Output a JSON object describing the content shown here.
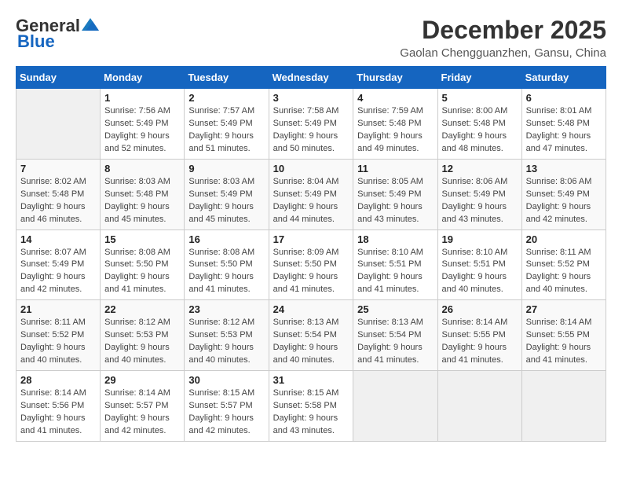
{
  "header": {
    "logo_general": "General",
    "logo_blue": "Blue",
    "month_year": "December 2025",
    "location": "Gaolan Chengguanzhen, Gansu, China"
  },
  "weekdays": [
    "Sunday",
    "Monday",
    "Tuesday",
    "Wednesday",
    "Thursday",
    "Friday",
    "Saturday"
  ],
  "weeks": [
    [
      {
        "day": "",
        "info": ""
      },
      {
        "day": "1",
        "info": "Sunrise: 7:56 AM\nSunset: 5:49 PM\nDaylight: 9 hours\nand 52 minutes."
      },
      {
        "day": "2",
        "info": "Sunrise: 7:57 AM\nSunset: 5:49 PM\nDaylight: 9 hours\nand 51 minutes."
      },
      {
        "day": "3",
        "info": "Sunrise: 7:58 AM\nSunset: 5:49 PM\nDaylight: 9 hours\nand 50 minutes."
      },
      {
        "day": "4",
        "info": "Sunrise: 7:59 AM\nSunset: 5:48 PM\nDaylight: 9 hours\nand 49 minutes."
      },
      {
        "day": "5",
        "info": "Sunrise: 8:00 AM\nSunset: 5:48 PM\nDaylight: 9 hours\nand 48 minutes."
      },
      {
        "day": "6",
        "info": "Sunrise: 8:01 AM\nSunset: 5:48 PM\nDaylight: 9 hours\nand 47 minutes."
      }
    ],
    [
      {
        "day": "7",
        "info": "Sunrise: 8:02 AM\nSunset: 5:48 PM\nDaylight: 9 hours\nand 46 minutes."
      },
      {
        "day": "8",
        "info": "Sunrise: 8:03 AM\nSunset: 5:48 PM\nDaylight: 9 hours\nand 45 minutes."
      },
      {
        "day": "9",
        "info": "Sunrise: 8:03 AM\nSunset: 5:49 PM\nDaylight: 9 hours\nand 45 minutes."
      },
      {
        "day": "10",
        "info": "Sunrise: 8:04 AM\nSunset: 5:49 PM\nDaylight: 9 hours\nand 44 minutes."
      },
      {
        "day": "11",
        "info": "Sunrise: 8:05 AM\nSunset: 5:49 PM\nDaylight: 9 hours\nand 43 minutes."
      },
      {
        "day": "12",
        "info": "Sunrise: 8:06 AM\nSunset: 5:49 PM\nDaylight: 9 hours\nand 43 minutes."
      },
      {
        "day": "13",
        "info": "Sunrise: 8:06 AM\nSunset: 5:49 PM\nDaylight: 9 hours\nand 42 minutes."
      }
    ],
    [
      {
        "day": "14",
        "info": "Sunrise: 8:07 AM\nSunset: 5:49 PM\nDaylight: 9 hours\nand 42 minutes."
      },
      {
        "day": "15",
        "info": "Sunrise: 8:08 AM\nSunset: 5:50 PM\nDaylight: 9 hours\nand 41 minutes."
      },
      {
        "day": "16",
        "info": "Sunrise: 8:08 AM\nSunset: 5:50 PM\nDaylight: 9 hours\nand 41 minutes."
      },
      {
        "day": "17",
        "info": "Sunrise: 8:09 AM\nSunset: 5:50 PM\nDaylight: 9 hours\nand 41 minutes."
      },
      {
        "day": "18",
        "info": "Sunrise: 8:10 AM\nSunset: 5:51 PM\nDaylight: 9 hours\nand 41 minutes."
      },
      {
        "day": "19",
        "info": "Sunrise: 8:10 AM\nSunset: 5:51 PM\nDaylight: 9 hours\nand 40 minutes."
      },
      {
        "day": "20",
        "info": "Sunrise: 8:11 AM\nSunset: 5:52 PM\nDaylight: 9 hours\nand 40 minutes."
      }
    ],
    [
      {
        "day": "21",
        "info": "Sunrise: 8:11 AM\nSunset: 5:52 PM\nDaylight: 9 hours\nand 40 minutes."
      },
      {
        "day": "22",
        "info": "Sunrise: 8:12 AM\nSunset: 5:53 PM\nDaylight: 9 hours\nand 40 minutes."
      },
      {
        "day": "23",
        "info": "Sunrise: 8:12 AM\nSunset: 5:53 PM\nDaylight: 9 hours\nand 40 minutes."
      },
      {
        "day": "24",
        "info": "Sunrise: 8:13 AM\nSunset: 5:54 PM\nDaylight: 9 hours\nand 40 minutes."
      },
      {
        "day": "25",
        "info": "Sunrise: 8:13 AM\nSunset: 5:54 PM\nDaylight: 9 hours\nand 41 minutes."
      },
      {
        "day": "26",
        "info": "Sunrise: 8:14 AM\nSunset: 5:55 PM\nDaylight: 9 hours\nand 41 minutes."
      },
      {
        "day": "27",
        "info": "Sunrise: 8:14 AM\nSunset: 5:55 PM\nDaylight: 9 hours\nand 41 minutes."
      }
    ],
    [
      {
        "day": "28",
        "info": "Sunrise: 8:14 AM\nSunset: 5:56 PM\nDaylight: 9 hours\nand 41 minutes."
      },
      {
        "day": "29",
        "info": "Sunrise: 8:14 AM\nSunset: 5:57 PM\nDaylight: 9 hours\nand 42 minutes."
      },
      {
        "day": "30",
        "info": "Sunrise: 8:15 AM\nSunset: 5:57 PM\nDaylight: 9 hours\nand 42 minutes."
      },
      {
        "day": "31",
        "info": "Sunrise: 8:15 AM\nSunset: 5:58 PM\nDaylight: 9 hours\nand 43 minutes."
      },
      {
        "day": "",
        "info": ""
      },
      {
        "day": "",
        "info": ""
      },
      {
        "day": "",
        "info": ""
      }
    ]
  ]
}
